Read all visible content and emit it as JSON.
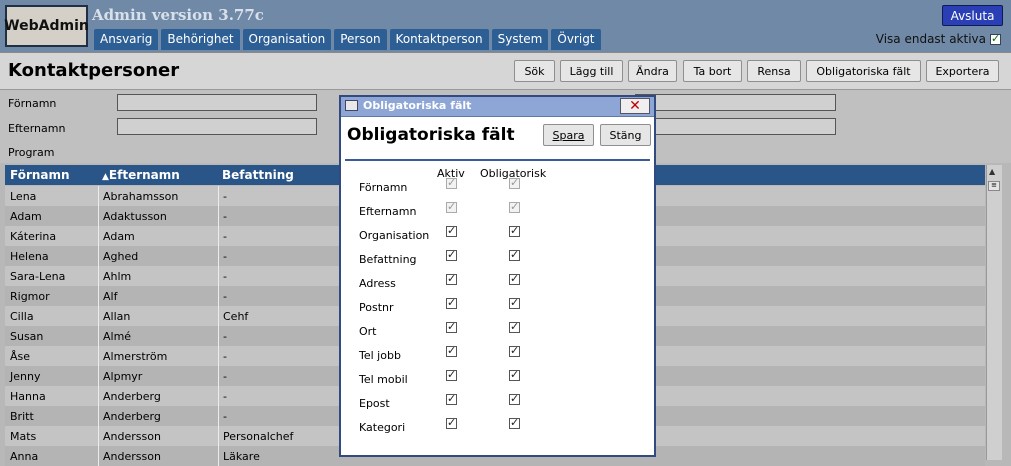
{
  "header": {
    "logo_text": "WebAdmin",
    "version": "Admin version 3.77c",
    "logout_label": "Avsluta",
    "tabs": [
      "Ansvarig",
      "Behörighet",
      "Organisation",
      "Person",
      "Kontaktperson",
      "System",
      "Övrigt"
    ],
    "show_active_label": "Visa endast aktiva",
    "show_active_checked": true
  },
  "toolbar": {
    "title": "Kontaktpersoner",
    "buttons": [
      "Sök",
      "Lägg till",
      "Ändra",
      "Ta bort",
      "Rensa",
      "Obligatoriska fält",
      "Exportera"
    ]
  },
  "filters": {
    "labels": [
      "Förnamn",
      "Efternamn",
      "Program"
    ]
  },
  "table": {
    "columns": [
      "Förnamn",
      "Efternamn",
      "Befattning"
    ],
    "sort_indicator": "▲",
    "rows": [
      [
        "Lena",
        "Abrahamsson",
        "-"
      ],
      [
        "Adam",
        "Adaktusson",
        "-"
      ],
      [
        "Káterina",
        "Adam",
        "-"
      ],
      [
        "Helena",
        "Aghed",
        "-"
      ],
      [
        "Sara-Lena",
        "Ahlm",
        "-"
      ],
      [
        "Rigmor",
        "Alf",
        "-"
      ],
      [
        "Cilla",
        "Allan",
        "Cehf"
      ],
      [
        "Susan",
        "Almé",
        "-"
      ],
      [
        "Åse",
        "Almerström",
        "-"
      ],
      [
        "Jenny",
        "Alpmyr",
        "-"
      ],
      [
        "Hanna",
        "Anderberg",
        "-"
      ],
      [
        "Britt",
        "Anderberg",
        "-"
      ],
      [
        "Mats",
        "Andersson",
        "Personalchef"
      ],
      [
        "Anna",
        "Andersson",
        "Läkare"
      ]
    ]
  },
  "dialog": {
    "title": "Obligatoriska fält",
    "heading": "Obligatoriska fält",
    "save_label": "Spara",
    "close_label": "Stäng",
    "close_icon": "✕",
    "col_active": "Aktiv",
    "col_required": "Obligatorisk",
    "fields": [
      {
        "label": "Förnamn",
        "active": true,
        "required": true,
        "locked": true
      },
      {
        "label": "Efternamn",
        "active": true,
        "required": true,
        "locked": true
      },
      {
        "label": "Organisation",
        "active": true,
        "required": true,
        "locked": false
      },
      {
        "label": "Befattning",
        "active": true,
        "required": true,
        "locked": false
      },
      {
        "label": "Adress",
        "active": true,
        "required": true,
        "locked": false
      },
      {
        "label": "Postnr",
        "active": true,
        "required": true,
        "locked": false
      },
      {
        "label": "Ort",
        "active": true,
        "required": true,
        "locked": false
      },
      {
        "label": "Tel jobb",
        "active": true,
        "required": true,
        "locked": false
      },
      {
        "label": "Tel mobil",
        "active": true,
        "required": true,
        "locked": false
      },
      {
        "label": "Epost",
        "active": true,
        "required": true,
        "locked": false
      },
      {
        "label": "Kategori",
        "active": true,
        "required": true,
        "locked": false
      }
    ]
  }
}
